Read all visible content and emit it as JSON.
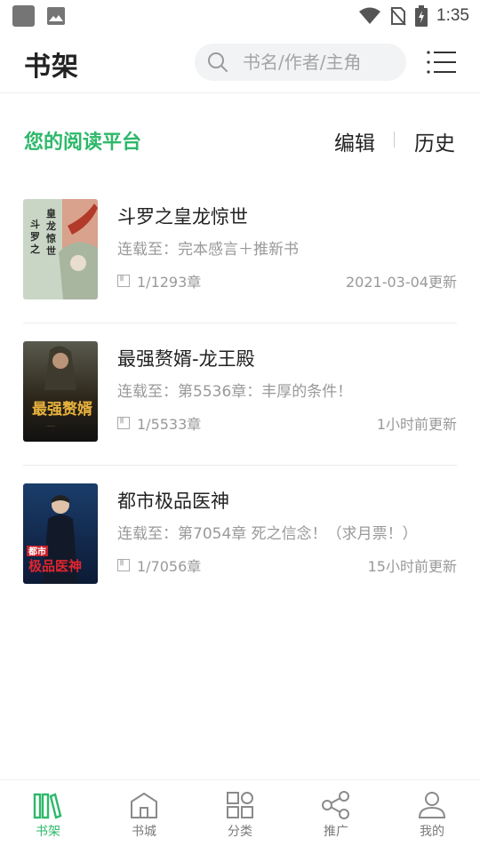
{
  "status_bar": {
    "time": "1:35"
  },
  "header": {
    "title": "书架",
    "search_placeholder": "书名/作者/主角"
  },
  "subheader": {
    "platform": "您的阅读平台",
    "edit": "编辑",
    "history": "历史"
  },
  "books": [
    {
      "title": "斗罗之皇龙惊世",
      "latest": "连载至：完本感言＋推新书",
      "progress": "1/1293章",
      "updated": "2021-03-04更新",
      "cover_text": "斗罗之皇龙惊世"
    },
    {
      "title": "最强赘婿-龙王殿",
      "latest": "连载至：第5536章：丰厚的条件！",
      "progress": "1/5533章",
      "updated": "1小时前更新",
      "cover_text": "最强赘婿"
    },
    {
      "title": "都市极品医神",
      "latest": "连载至：第7054章 死之信念！（求月票！）",
      "progress": "1/7056章",
      "updated": "15小时前更新",
      "cover_text": "都市极品医神"
    }
  ],
  "tabs": [
    {
      "label": "书架",
      "icon": "bookshelf-icon",
      "active": true
    },
    {
      "label": "书城",
      "icon": "bookstore-icon",
      "active": false
    },
    {
      "label": "分类",
      "icon": "category-icon",
      "active": false
    },
    {
      "label": "推广",
      "icon": "share-icon",
      "active": false
    },
    {
      "label": "我的",
      "icon": "profile-icon",
      "active": false
    }
  ],
  "colors": {
    "accent": "#2db86a",
    "text": "#222222",
    "muted": "#999999"
  }
}
